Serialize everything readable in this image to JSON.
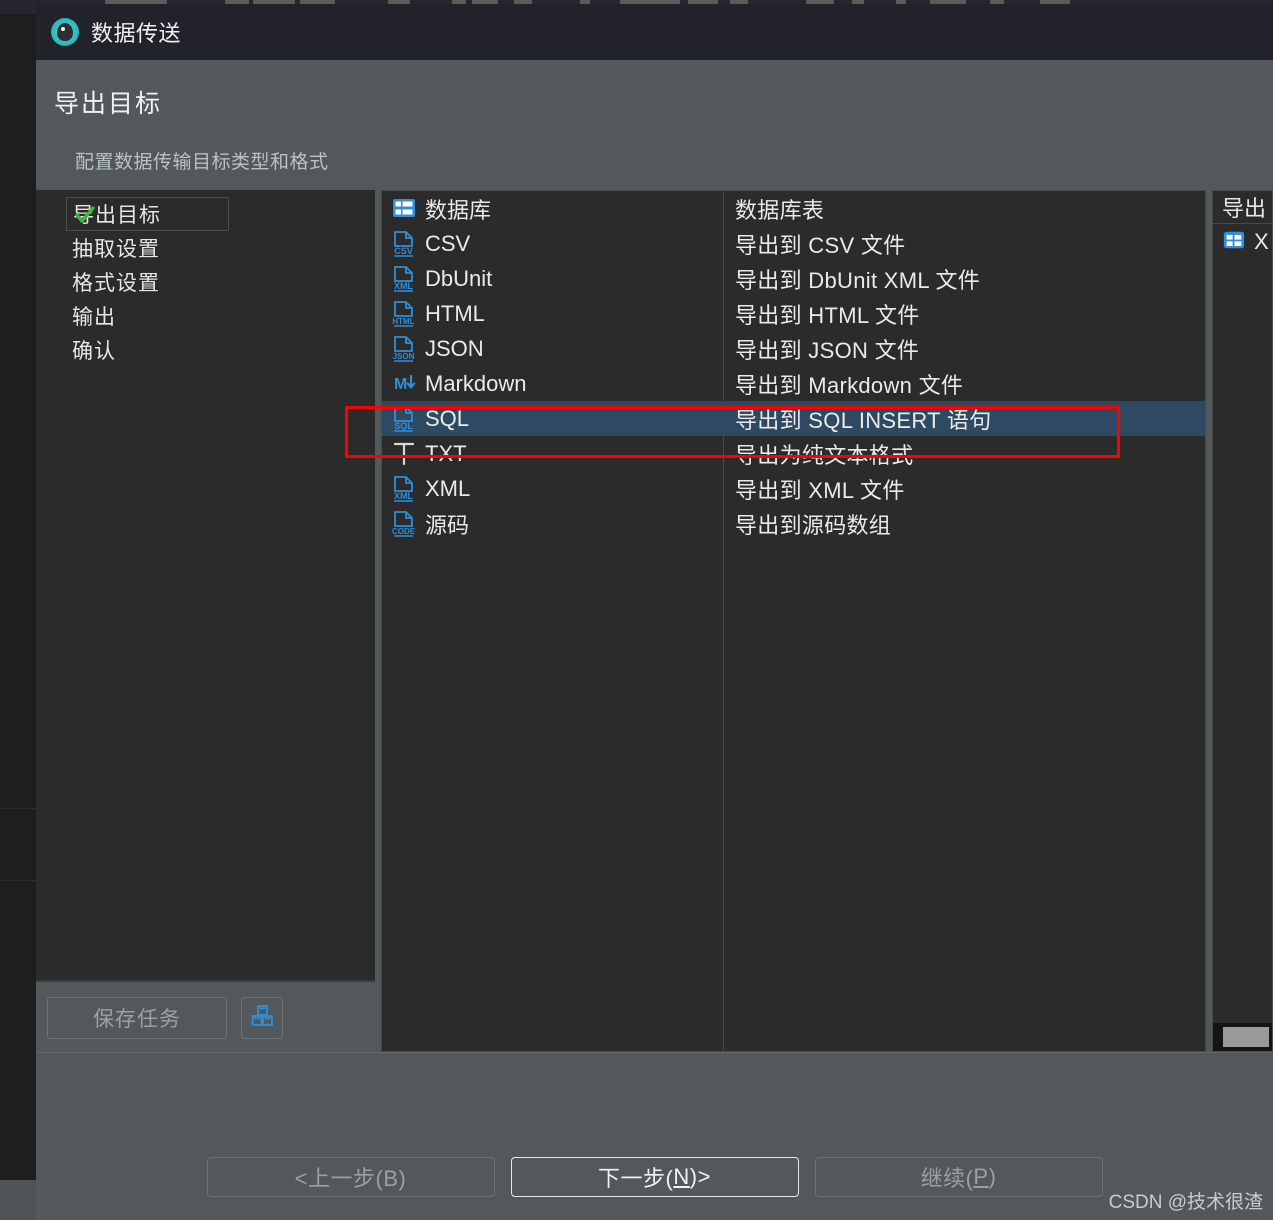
{
  "window": {
    "title": "数据传送",
    "logo_icon": "dbeaver-logo-icon"
  },
  "header": {
    "title": "导出目标",
    "subtitle": "配置数据传输目标类型和格式"
  },
  "sidebar": {
    "items": [
      {
        "label": "导出目标",
        "state": "completed-current",
        "icon": "check-icon"
      },
      {
        "label": "抽取设置",
        "state": "pending"
      },
      {
        "label": "格式设置",
        "state": "pending"
      },
      {
        "label": "输出",
        "state": "pending"
      },
      {
        "label": "确认",
        "state": "pending"
      }
    ],
    "save_task_label": "保存任务",
    "save_task_enabled": false,
    "task_icon": "boxes-icon"
  },
  "target_list": {
    "rows": [
      {
        "name": "数据库",
        "desc": "数据库表",
        "icon": "database-table-icon",
        "badge": "",
        "selected": false
      },
      {
        "name": "CSV",
        "desc": "导出到 CSV 文件",
        "icon": "file-csv-icon",
        "badge": "CSV",
        "selected": false
      },
      {
        "name": "DbUnit",
        "desc": "导出到 DbUnit XML 文件",
        "icon": "file-xml-icon",
        "badge": "XML",
        "selected": false
      },
      {
        "name": "HTML",
        "desc": "导出到 HTML 文件",
        "icon": "file-html-icon",
        "badge": "HTML",
        "selected": false
      },
      {
        "name": "JSON",
        "desc": "导出到 JSON 文件",
        "icon": "file-json-icon",
        "badge": "JSON",
        "selected": false
      },
      {
        "name": "Markdown",
        "desc": "导出到 Markdown 文件",
        "icon": "markdown-icon",
        "badge": "M",
        "selected": false
      },
      {
        "name": "SQL",
        "desc": "导出到 SQL INSERT 语句",
        "icon": "file-sql-icon",
        "badge": "SQL",
        "selected": true
      },
      {
        "name": "TXT",
        "desc": "导出为纯文本格式",
        "icon": "text-t-icon",
        "badge": "",
        "selected": false
      },
      {
        "name": "XML",
        "desc": "导出到 XML 文件",
        "icon": "file-xml-icon",
        "badge": "XML",
        "selected": false
      },
      {
        "name": "源码",
        "desc": "导出到源码数组",
        "icon": "file-code-icon",
        "badge": "CODE",
        "selected": false
      }
    ],
    "selected_index": 6,
    "highlight_color": "#2e4a63"
  },
  "right_panel": {
    "header": "导出",
    "row_label": "X",
    "row_icon": "spreadsheet-grid-icon"
  },
  "footer": {
    "back_label": "<上一步(B)",
    "back_enabled": false,
    "next_label_pre": "下一步(",
    "next_label_key": "N",
    "next_label_post": ")>",
    "next_enabled": true,
    "proceed_label_pre": "继续(",
    "proceed_label_key": "P",
    "proceed_label_post": ")",
    "proceed_enabled": false
  },
  "watermark": "CSDN @技术很渣",
  "annotation": {
    "shape": "rectangle",
    "color": "#ff0000",
    "target": "SQL row"
  }
}
